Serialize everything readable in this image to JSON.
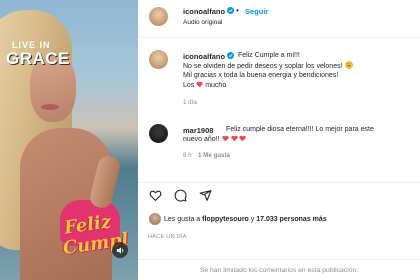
{
  "post": {
    "author": "iconoalfano",
    "follow_label": "Seguir",
    "dot": "•",
    "audio_label": "Audio original"
  },
  "video_overlay": {
    "logo_line1": "LIVE IN",
    "logo_line2": "GRACE",
    "sticker_line1": "Feliz",
    "sticker_line2": "Cumpl"
  },
  "caption": {
    "author": "iconoalfano",
    "line1": "Feliz Cumple a mi!!!",
    "line2": "No se olviden de pedir deseos y soplar los velones!",
    "line3": "Mil gracias x toda la buena energia y bendiciones!",
    "line4_prefix": "Los",
    "line4_suffix": "mucho",
    "time": "1 día"
  },
  "comments": [
    {
      "author": "mar1908",
      "text_line1": "Feliz cumple diosa eterna!!!! Lo mejor para este",
      "text_line2": "nuevo año!!",
      "time": "8 h",
      "likes": "1 Me gusta"
    }
  ],
  "likes": {
    "prefix": "Les gusta a",
    "user": "floppytesouro",
    "middle": "y",
    "count": "17.033 personas más"
  },
  "timestamp": "HACE UN DÍA",
  "comments_limited": "Se han limitado los comentarios en esta publicación.",
  "colors": {
    "accent": "#0095f6",
    "heart_red": "#ed4956",
    "verified_blue": "#0095f6"
  }
}
